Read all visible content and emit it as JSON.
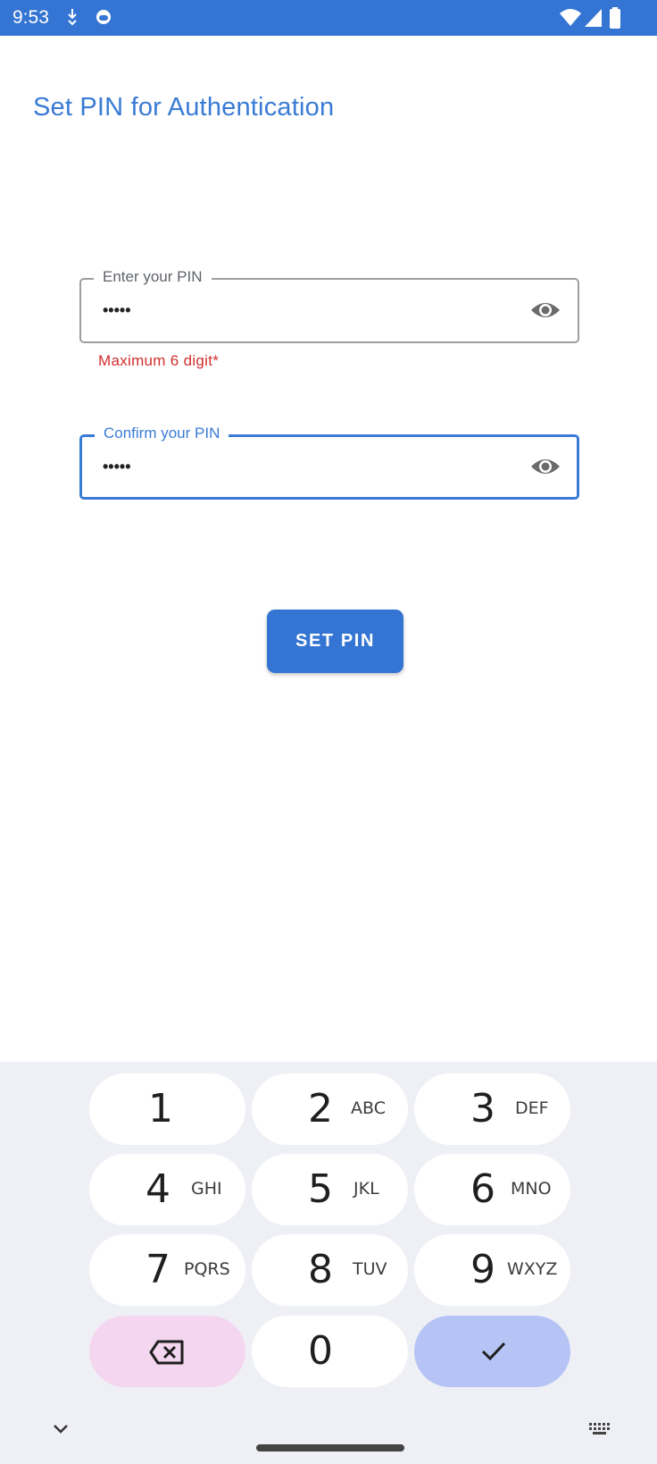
{
  "status_bar": {
    "time": "9:53",
    "left_icons": [
      "download-arrow-icon",
      "app-face-icon"
    ],
    "right_icons": [
      "wifi-icon",
      "cell-signal-icon",
      "battery-icon"
    ],
    "background": "#3475d3"
  },
  "screen": {
    "title": "Set PIN for Authentication",
    "accent_color": "#3a7bd5"
  },
  "pin_field": {
    "label": "Enter your PIN",
    "value": "•••••",
    "toggle_icon": "eye-icon"
  },
  "error_message": "Maximum 6 digit*",
  "confirm_field": {
    "label": "Confirm your PIN",
    "value": "•••••",
    "toggle_icon": "eye-icon",
    "focused": true
  },
  "submit_button": {
    "label": "SET PIN"
  },
  "keyboard": {
    "keys": [
      {
        "digit": "1",
        "letters": ""
      },
      {
        "digit": "2",
        "letters": "ABC"
      },
      {
        "digit": "3",
        "letters": "DEF"
      },
      {
        "digit": "4",
        "letters": "GHI"
      },
      {
        "digit": "5",
        "letters": "JKL"
      },
      {
        "digit": "6",
        "letters": "MNO"
      },
      {
        "digit": "7",
        "letters": "PQRS"
      },
      {
        "digit": "8",
        "letters": "TUV"
      },
      {
        "digit": "9",
        "letters": "WXYZ"
      },
      {
        "digit": "0",
        "letters": ""
      }
    ],
    "backspace_icon": "backspace-icon",
    "enter_icon": "checkmark-icon",
    "collapse_icon": "chevron-down-icon",
    "switch_icon": "keyboard-icon"
  }
}
